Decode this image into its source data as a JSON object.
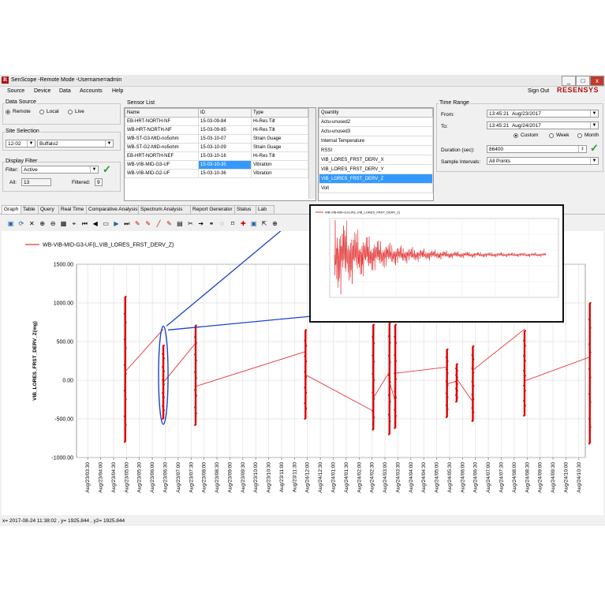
{
  "window": {
    "title": "SenScope -Remote Mode -Username=admin",
    "logo_letter": "R",
    "min": "_",
    "max": "□",
    "close": "x"
  },
  "menu": [
    "Source",
    "Device",
    "Data",
    "Accounts",
    "Help"
  ],
  "signout": "Sign Out",
  "brand": "RESENSYS",
  "data_source": {
    "label": "Data Source",
    "options": [
      "Remote",
      "Local",
      "Live"
    ],
    "selected": "Remote"
  },
  "site": {
    "label": "Site Selection",
    "code": "12-02",
    "name": "Buffalo2"
  },
  "display_filter": {
    "label": "Display Filter",
    "filter_label": "Filter:",
    "filter_value": "Active",
    "all_label": "All:",
    "all_value": "13",
    "filtered_label": "Filtered:",
    "filtered_value": "9"
  },
  "sensor_list": {
    "label": "Sensor List",
    "columns": [
      "Name",
      "ID",
      "Type"
    ],
    "rows": [
      [
        "EB-HRT-NORTH-NF",
        "15-03-09-84",
        "Hi-Res Tilt"
      ],
      [
        "WB-HRT-NORTH-NF",
        "15-03-09-85",
        "Hi-Res Tilt"
      ],
      [
        "WB-ST-G3-MID-no5ohm",
        "15-03-10-07",
        "Strain Guage"
      ],
      [
        "WB-ST-G2-MID-no5ohm",
        "15-03-10-09",
        "Strain Guage"
      ],
      [
        "EB-HRT-NORTH-NEF",
        "15-03-10-16",
        "Hi-Res Tilt"
      ],
      [
        "WB-VIB-MID-G3-UF",
        "15-03-10-35",
        "Vibration"
      ],
      [
        "WB-VIB-MID-G2-UF",
        "15-03-10-36",
        "Vibration"
      ]
    ],
    "selected_row": 5
  },
  "quantity": {
    "header": "Quantity",
    "items": [
      "Actu-unused2",
      "Actu-unused3",
      "Internal Temperature",
      "RSSI",
      "VIB_LORES_FRST_DERV_X",
      "VIB_LORES_FRST_DERV_Y",
      "VIB_LORES_FRST_DERV_Z",
      "Volt"
    ],
    "selected": 6
  },
  "time_range": {
    "label": "Time Range",
    "from_label": "From:",
    "from_time": "13:45:21",
    "from_date": "Aug/23/2017",
    "to_label": "To:",
    "to_time": "13:45:21",
    "to_date": "Aug/24/2017",
    "modes": [
      "Custom",
      "Week",
      "Month"
    ],
    "mode_selected": "Custom",
    "duration_label": "Duration (sec):",
    "duration": "86400",
    "interval_label": "Sample Intervals:",
    "interval": "All Points"
  },
  "tabs": [
    "Graph",
    "Table",
    "Query",
    "Real Time",
    "Comparative Analysis",
    "Spectrum Analysis",
    "Report Generator",
    "Status",
    "Lab"
  ],
  "toolbar_icons": [
    "save-icon",
    "refresh-icon",
    "close-icon",
    "zoom-in-icon",
    "zoom-out-icon",
    "color-icon",
    "cursor-icon",
    "first-icon",
    "back-icon",
    "screen-icon",
    "play-icon",
    "last-icon",
    "pen-icon",
    "pen-icon",
    "line-icon",
    "pen-icon",
    "chart-icon",
    "cut-icon",
    "arrow-icon",
    "link-icon",
    "lasso-icon",
    "marker-icon",
    "pin-icon",
    "save-icon",
    "export-icon",
    "add-icon"
  ],
  "chart_data": {
    "type": "line",
    "legend": "WB-VIB-MID-G3-UF(L,VIB_LORES_FRST_DERV_Z)",
    "ylabel": "VIB_LORES_FRST_DERV_Z(mg)",
    "ylim": [
      -1000,
      1500
    ],
    "yticks": [
      "1500.00",
      "1000.00",
      "500.00",
      "0.00",
      "-500.00",
      "-1000.00"
    ],
    "xticks": [
      "Aug/23/03:30",
      "Aug/23/04:00",
      "Aug/23/04:30",
      "Aug/23/05:00",
      "Aug/23/05:30",
      "Aug/23/06:00",
      "Aug/23/06:30",
      "Aug/23/07:00",
      "Aug/23/07:30",
      "Aug/23/08:00",
      "Aug/23/08:30",
      "Aug/23/09:00",
      "Aug/23/09:30",
      "Aug/23/10:00",
      "Aug/23/10:30",
      "Aug/23/11:00",
      "Aug/23/11:30",
      "Aug/24/12:00",
      "Aug/24/12:30",
      "Aug/24/01:00",
      "Aug/24/01:30",
      "Aug/24/02:00",
      "Aug/24/02:30",
      "Aug/24/03:00",
      "Aug/24/03:30",
      "Aug/24/04:00",
      "Aug/24/04:30",
      "Aug/24/05:00",
      "Aug/24/05:30",
      "Aug/24/06:00",
      "Aug/24/06:30",
      "Aug/24/07:00",
      "Aug/24/07:30",
      "Aug/24/08:00",
      "Aug/24/08:30",
      "Aug/24/09:00",
      "Aug/24/09:30",
      "Aug/24/10:00",
      "Aug/24/10:30"
    ],
    "bursts": [
      {
        "x": 3.4,
        "min": -800,
        "max": 1080
      },
      {
        "x": 6.35,
        "min": -500,
        "max": 450
      },
      {
        "x": 8.85,
        "min": -580,
        "max": 710
      },
      {
        "x": 17.35,
        "min": -500,
        "max": 650
      },
      {
        "x": 22.6,
        "min": -640,
        "max": 720
      },
      {
        "x": 23.85,
        "min": -700,
        "max": 740
      },
      {
        "x": 24.3,
        "min": -620,
        "max": 720
      },
      {
        "x": 28.3,
        "min": -480,
        "max": 400
      },
      {
        "x": 29.05,
        "min": -280,
        "max": 210
      },
      {
        "x": 30.3,
        "min": -530,
        "max": 440
      },
      {
        "x": 34.3,
        "min": -460,
        "max": 640
      },
      {
        "x": 39.35,
        "min": -820,
        "max": 1000
      }
    ],
    "connectors": [
      [
        3.4,
        110,
        6.35,
        660
      ],
      [
        6.35,
        -30,
        8.85,
        480
      ],
      [
        8.85,
        -80,
        17.35,
        370
      ],
      [
        17.35,
        70,
        22.6,
        -400
      ],
      [
        22.6,
        -230,
        23.85,
        110
      ],
      [
        23.85,
        -20,
        24.3,
        -280
      ],
      [
        24.3,
        90,
        28.3,
        170
      ],
      [
        28.3,
        -50,
        29.05,
        -10
      ],
      [
        29.05,
        20,
        30.3,
        -280
      ],
      [
        30.3,
        130,
        34.3,
        660
      ],
      [
        34.3,
        -10,
        39.35,
        300
      ]
    ],
    "inset_title": "WB-VIB-MID-G3-UF(L,VIB_LORES_FRST_DERV_Z)"
  },
  "status": "x= 2017-08-24 11:38:02 , y= 1925.844 , y2= 1925.844"
}
